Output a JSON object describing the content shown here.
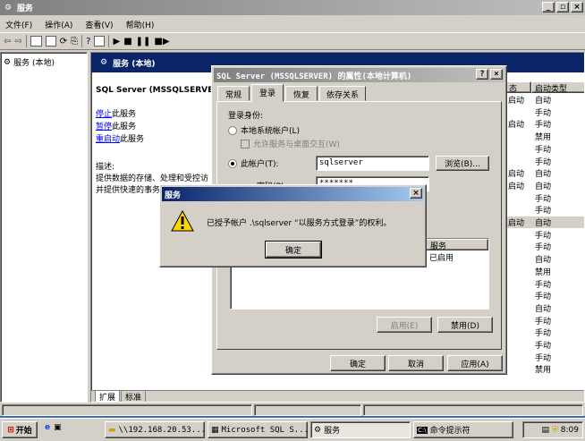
{
  "mainWindow": {
    "title": "服务",
    "controls": [
      "_",
      "▫",
      "×"
    ],
    "menu": [
      "文件(F)",
      "操作(A)",
      "查看(V)",
      "帮助(H)"
    ],
    "treeItem": "服务 (本地)",
    "headerTitle": "服务 (本地)",
    "selectedService": "SQL Server (MSSQLSERVER)",
    "links": [
      {
        "label": "停止",
        "suffix": "此服务"
      },
      {
        "label": "暂停",
        "suffix": "此服务"
      },
      {
        "label": "重启动",
        "suffix": "此服务"
      }
    ],
    "descLabel": "描述:",
    "descText": [
      "提供数据的存储、处理和受控访",
      "并提供快速的事务处理。"
    ],
    "columns": {
      "col1": "态",
      "col2": "启动类型"
    },
    "rows": [
      {
        "status": "启动",
        "startup": "自动"
      },
      {
        "status": "",
        "startup": "手动"
      },
      {
        "status": "启动",
        "startup": "手动"
      },
      {
        "status": "",
        "startup": "禁用"
      },
      {
        "status": "",
        "startup": "手动"
      },
      {
        "status": "",
        "startup": "手动"
      },
      {
        "status": "启动",
        "startup": "自动"
      },
      {
        "status": "启动",
        "startup": "自动"
      },
      {
        "status": "",
        "startup": "手动"
      },
      {
        "status": "",
        "startup": "手动"
      },
      {
        "status": "启动",
        "startup": "自动"
      },
      {
        "status": "",
        "startup": "手动"
      },
      {
        "status": "",
        "startup": "手动"
      },
      {
        "status": "",
        "startup": "自动"
      },
      {
        "status": "",
        "startup": "禁用"
      },
      {
        "status": "",
        "startup": "手动"
      },
      {
        "status": "",
        "startup": "手动"
      },
      {
        "status": "",
        "startup": "自动"
      },
      {
        "status": "",
        "startup": "手动"
      },
      {
        "status": "",
        "startup": "手动"
      },
      {
        "status": "",
        "startup": "手动"
      },
      {
        "status": "",
        "startup": "手动"
      },
      {
        "status": "",
        "startup": "禁用"
      }
    ],
    "bottomTabs": [
      "扩展",
      "标准"
    ]
  },
  "propsDialog": {
    "title": "SQL Server (MSSQLSERVER) 的属性(本地计算机)",
    "tabs": [
      "常规",
      "登录",
      "恢复",
      "依存关系"
    ],
    "logonAs": "登录身份:",
    "localSystem": "本地系统帐户(L)",
    "allowDesktop": "允许服务与桌面交互(W)",
    "thisAccount": "此帐户(T):",
    "accountValue": "sqlserver",
    "browse": "浏览(B)...",
    "passwordLabel": "密码(P):",
    "passwordValue": "*******",
    "listHeader": "服务",
    "listValue": "已启用",
    "enable": "启用(E)",
    "disable": "禁用(D)",
    "ok": "确定",
    "cancel": "取消",
    "apply": "应用(A)"
  },
  "msgBox": {
    "title": "服务",
    "message": "已授予帐户 .\\sqlserver “以服务方式登录”的权利。",
    "ok": "确定"
  },
  "taskbar": {
    "start": "开始",
    "tasks": [
      "\\\\192.168.20.53...",
      "Microsoft SQL S...",
      "服务",
      "命令提示符"
    ],
    "clock": "8:09"
  }
}
